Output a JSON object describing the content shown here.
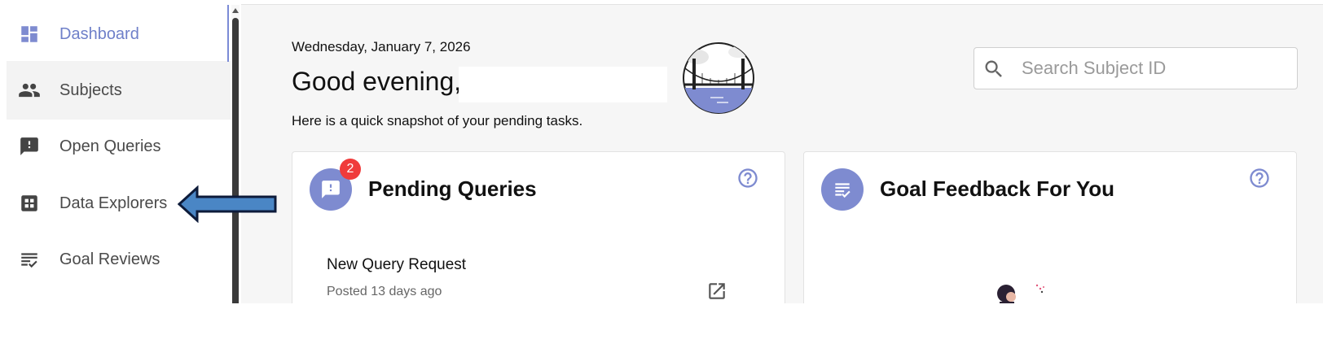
{
  "sidebar": {
    "items": [
      {
        "label": "Dashboard",
        "icon": "dashboard-icon",
        "active": true
      },
      {
        "label": "Subjects",
        "icon": "people-icon"
      },
      {
        "label": "Open Queries",
        "icon": "feedback-icon"
      },
      {
        "label": "Data Explorers",
        "icon": "grid-icon"
      },
      {
        "label": "Goal Reviews",
        "icon": "checklist-icon"
      }
    ]
  },
  "header": {
    "date": "Wednesday, January 7, 2026",
    "greeting": "Good evening,",
    "subtitle": "Here is a quick snapshot of your pending tasks."
  },
  "search": {
    "placeholder": "Search Subject ID",
    "value": ""
  },
  "cards": {
    "pending": {
      "title": "Pending Queries",
      "badge": "2",
      "items": [
        {
          "title": "New Query Request",
          "meta": "Posted 13 days ago"
        }
      ]
    },
    "goals": {
      "title": "Goal Feedback For You"
    }
  },
  "colors": {
    "accent": "#7e8bd0",
    "badge": "#f03b3b",
    "arrow_fill": "#4a86c5",
    "arrow_stroke": "#0d1b3a"
  }
}
